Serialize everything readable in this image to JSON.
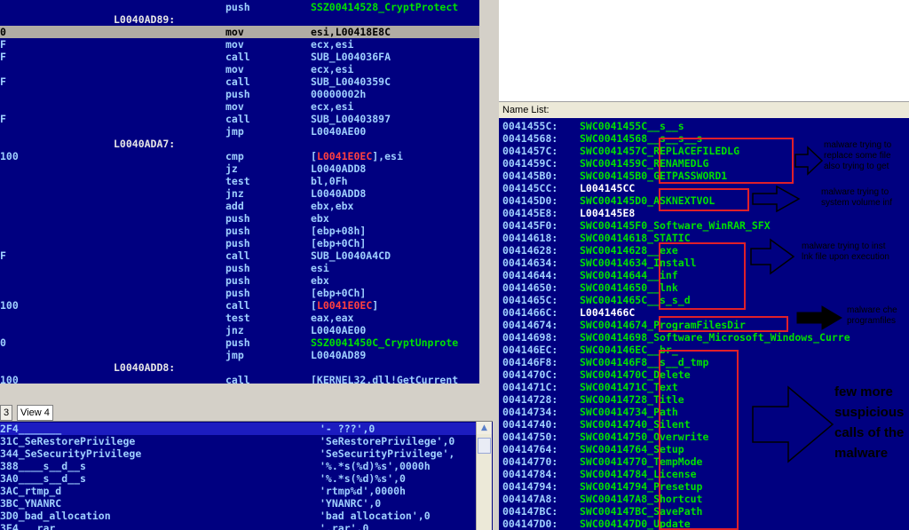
{
  "disasm": {
    "rows": [
      {
        "prefix": "",
        "label": "",
        "mnem": "push",
        "op": "SSZ00414528_CryptProtect",
        "op_color": "green",
        "sel": false
      },
      {
        "prefix": "",
        "label": "L0040AD89:",
        "mnem": "",
        "op": "",
        "sel": false
      },
      {
        "prefix": "0",
        "label": "",
        "mnem": "mov",
        "op": "esi,L00418E8C",
        "sel": true
      },
      {
        "prefix": "F",
        "label": "",
        "mnem": "mov",
        "op": "ecx,esi",
        "sel": false
      },
      {
        "prefix": "F",
        "label": "",
        "mnem": "call",
        "op": "SUB_L004036FA",
        "sel": false
      },
      {
        "prefix": "",
        "label": "",
        "mnem": "mov",
        "op": "ecx,esi",
        "sel": false
      },
      {
        "prefix": "F",
        "label": "",
        "mnem": "call",
        "op": "SUB_L0040359C",
        "sel": false
      },
      {
        "prefix": "",
        "label": "",
        "mnem": "push",
        "op": "00000002h",
        "sel": false
      },
      {
        "prefix": "",
        "label": "",
        "mnem": "mov",
        "op": "ecx,esi",
        "sel": false
      },
      {
        "prefix": "F",
        "label": "",
        "mnem": "call",
        "op": "SUB_L00403897",
        "sel": false
      },
      {
        "prefix": "",
        "label": "",
        "mnem": "jmp",
        "op": "L0040AE00",
        "sel": false
      },
      {
        "prefix": "",
        "label": "L0040ADA7:",
        "mnem": "",
        "op": "",
        "sel": false
      },
      {
        "prefix": "100",
        "label": "",
        "mnem": "cmp",
        "op": "[L0041E0EC],esi",
        "op_red": "L0041E0EC",
        "sel": false
      },
      {
        "prefix": "",
        "label": "",
        "mnem": "jz",
        "op": "L0040ADD8",
        "sel": false
      },
      {
        "prefix": "",
        "label": "",
        "mnem": "test",
        "op": "bl,0Fh",
        "sel": false
      },
      {
        "prefix": "",
        "label": "",
        "mnem": "jnz",
        "op": "L0040ADD8",
        "sel": false
      },
      {
        "prefix": "",
        "label": "",
        "mnem": "add",
        "op": "ebx,ebx",
        "sel": false
      },
      {
        "prefix": "",
        "label": "",
        "mnem": "push",
        "op": "ebx",
        "sel": false
      },
      {
        "prefix": "",
        "label": "",
        "mnem": "push",
        "op": "[ebp+08h]",
        "sel": false
      },
      {
        "prefix": "",
        "label": "",
        "mnem": "push",
        "op": "[ebp+0Ch]",
        "sel": false
      },
      {
        "prefix": "F",
        "label": "",
        "mnem": "call",
        "op": "SUB_L0040A4CD",
        "sel": false
      },
      {
        "prefix": "",
        "label": "",
        "mnem": "push",
        "op": "esi",
        "sel": false
      },
      {
        "prefix": "",
        "label": "",
        "mnem": "push",
        "op": "ebx",
        "sel": false
      },
      {
        "prefix": "",
        "label": "",
        "mnem": "push",
        "op": "[ebp+0Ch]",
        "sel": false
      },
      {
        "prefix": "100",
        "label": "",
        "mnem": "call",
        "op": "[L0041E0EC]",
        "op_red": "L0041E0EC",
        "sel": false
      },
      {
        "prefix": "",
        "label": "",
        "mnem": "test",
        "op": "eax,eax",
        "sel": false
      },
      {
        "prefix": "",
        "label": "",
        "mnem": "jnz",
        "op": "L0040AE00",
        "sel": false
      },
      {
        "prefix": "0",
        "label": "",
        "mnem": "push",
        "op": "SSZ0041450C_CryptUnprote",
        "op_color": "green",
        "sel": false
      },
      {
        "prefix": "",
        "label": "",
        "mnem": "jmp",
        "op": "L0040AD89",
        "sel": false
      },
      {
        "prefix": "",
        "label": "L0040ADD8:",
        "mnem": "",
        "op": "",
        "sel": false
      },
      {
        "prefix": "100",
        "label": "",
        "mnem": "call",
        "op": "[KERNEL32.dll!GetCurrent",
        "sel": false
      }
    ]
  },
  "tabs": [
    {
      "label": "3",
      "active": false
    },
    {
      "label": "View 4",
      "active": true
    }
  ],
  "strings": {
    "rows": [
      {
        "name": "2F4_______",
        "value": "'- ???',0",
        "hdr": true
      },
      {
        "name": "31C_SeRestorePrivilege",
        "value": "'SeRestorePrivilege',0"
      },
      {
        "name": "344_SeSecurityPrivilege",
        "value": "'SeSecurityPrivilege',"
      },
      {
        "name": "388____s__d__s",
        "value": "'%.*s(%d)%s',0000h"
      },
      {
        "name": "3A0____s__d__s",
        "value": "'%.*s(%d)%s',0"
      },
      {
        "name": "3AC_rtmp_d",
        "value": "'rtmp%d',0000h"
      },
      {
        "name": "3BC_YNANRC",
        "value": "'YNANRC',0"
      },
      {
        "name": "3D0_bad_allocation",
        "value": "'bad allocation',0"
      },
      {
        "name": "3E4___rar",
        "value": "'.rar',0"
      }
    ]
  },
  "namelist": {
    "title": "Name List:",
    "rows": [
      {
        "addr": "0041455C:",
        "name": "SWC0041455C__s__s"
      },
      {
        "addr": "00414568:",
        "name": "SWC00414568__s__s__s"
      },
      {
        "addr": "0041457C:",
        "name": "SWC0041457C_REPLACEFILEDLG"
      },
      {
        "addr": "0041459C:",
        "name": "SWC0041459C_RENAMEDLG"
      },
      {
        "addr": "004145B0:",
        "name": "SWC004145B0_GETPASSWORD1"
      },
      {
        "addr": "004145CC:",
        "name": "L004145CC",
        "plain": true
      },
      {
        "addr": "004145D0:",
        "name": "SWC004145D0_ASKNEXTVOL"
      },
      {
        "addr": "004145E8:",
        "name": "L004145E8",
        "plain": true
      },
      {
        "addr": "004145F0:",
        "name": "SWC004145F0_Software_WinRAR_SFX"
      },
      {
        "addr": "00414618:",
        "name": "SWC00414618_STATIC"
      },
      {
        "addr": "00414628:",
        "name": "SWC00414628__exe"
      },
      {
        "addr": "00414634:",
        "name": "SWC00414634_Install"
      },
      {
        "addr": "00414644:",
        "name": "SWC00414644__inf"
      },
      {
        "addr": "00414650:",
        "name": "SWC00414650__lnk"
      },
      {
        "addr": "0041465C:",
        "name": "SWC0041465C__s_s_d"
      },
      {
        "addr": "0041466C:",
        "name": "L0041466C",
        "plain": true
      },
      {
        "addr": "00414674:",
        "name": "SWC00414674_ProgramFilesDir"
      },
      {
        "addr": "00414698:",
        "name": "SWC00414698_Software_Microsoft_Windows_Curre"
      },
      {
        "addr": "004146EC:",
        "name": "SWC004146EC__br_"
      },
      {
        "addr": "004146F8:",
        "name": "SWC004146F8__s__d_tmp"
      },
      {
        "addr": "0041470C:",
        "name": "SWC0041470C_Delete"
      },
      {
        "addr": "0041471C:",
        "name": "SWC0041471C_Text"
      },
      {
        "addr": "00414728:",
        "name": "SWC00414728_Title"
      },
      {
        "addr": "00414734:",
        "name": "SWC00414734_Path"
      },
      {
        "addr": "00414740:",
        "name": "SWC00414740_Silent"
      },
      {
        "addr": "00414750:",
        "name": "SWC00414750_Overwrite"
      },
      {
        "addr": "00414764:",
        "name": "SWC00414764_Setup"
      },
      {
        "addr": "00414770:",
        "name": "SWC00414770_TempMode"
      },
      {
        "addr": "00414784:",
        "name": "SWC00414784_License"
      },
      {
        "addr": "00414794:",
        "name": "SWC00414794_Presetup"
      },
      {
        "addr": "004147A8:",
        "name": "SWC004147A8_Shortcut"
      },
      {
        "addr": "004147BC:",
        "name": "SWC004147BC_SavePath"
      },
      {
        "addr": "004147D0:",
        "name": "SWC004147D0_Update"
      }
    ]
  },
  "annotations": {
    "note1": "malware trying to\nreplace some file\nalso trying to get",
    "note2": "malware trying to\nsystem volume inf",
    "note3": "malware trying to inst\nlnk file upon execution",
    "note4": "malware che\nprogramfiles",
    "note5": "few more\nsuspicious\ncalls of the\nmalware"
  },
  "colors": {
    "pane_bg": "#000080",
    "highlight_box": "#e0202a",
    "name_green": "#00e000"
  }
}
